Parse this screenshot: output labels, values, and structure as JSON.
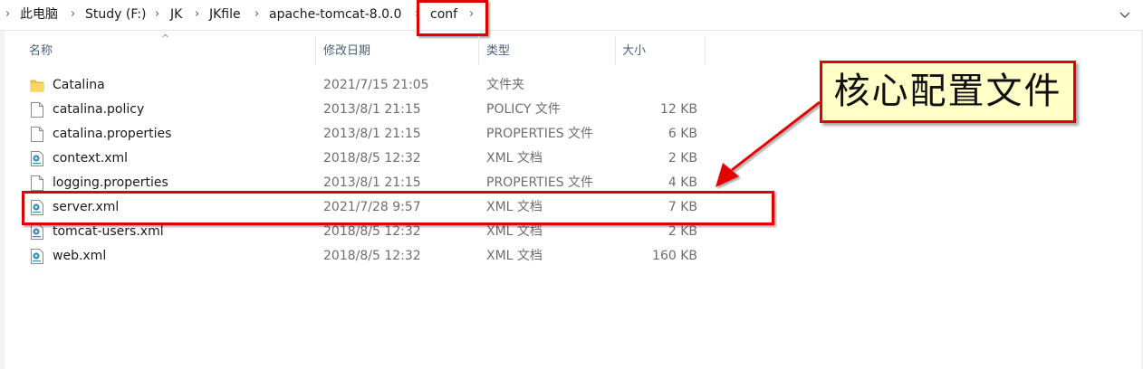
{
  "breadcrumb": {
    "items": [
      "此电脑",
      "Study (F:)",
      "JK",
      "JKfile",
      "apache-tomcat-8.0.0",
      "conf"
    ]
  },
  "columns": {
    "name": "名称",
    "date": "修改日期",
    "type": "类型",
    "size": "大小"
  },
  "files": [
    {
      "name": "Catalina",
      "date": "2021/7/15 21:05",
      "type": "文件夹",
      "size": "",
      "icon": "folder-icon"
    },
    {
      "name": "catalina.policy",
      "date": "2013/8/1 21:15",
      "type": "POLICY 文件",
      "size": "12 KB",
      "icon": "file-icon"
    },
    {
      "name": "catalina.properties",
      "date": "2013/8/1 21:15",
      "type": "PROPERTIES 文件",
      "size": "6 KB",
      "icon": "file-icon"
    },
    {
      "name": "context.xml",
      "date": "2018/8/5 12:32",
      "type": "XML 文档",
      "size": "2 KB",
      "icon": "xml-file-icon"
    },
    {
      "name": "logging.properties",
      "date": "2013/8/1 21:15",
      "type": "PROPERTIES 文件",
      "size": "4 KB",
      "icon": "file-icon"
    },
    {
      "name": "server.xml",
      "date": "2021/7/28 9:57",
      "type": "XML 文档",
      "size": "7 KB",
      "icon": "xml-file-icon"
    },
    {
      "name": "tomcat-users.xml",
      "date": "2018/8/5 12:32",
      "type": "XML 文档",
      "size": "2 KB",
      "icon": "xml-file-icon"
    },
    {
      "name": "web.xml",
      "date": "2018/8/5 12:32",
      "type": "XML 文档",
      "size": "160 KB",
      "icon": "xml-file-icon"
    }
  ],
  "callout": {
    "text": "核心配置文件"
  },
  "colors": {
    "highlight": "#e00000",
    "callout_bg": "#ffffc8",
    "header_text": "#4c607a"
  }
}
